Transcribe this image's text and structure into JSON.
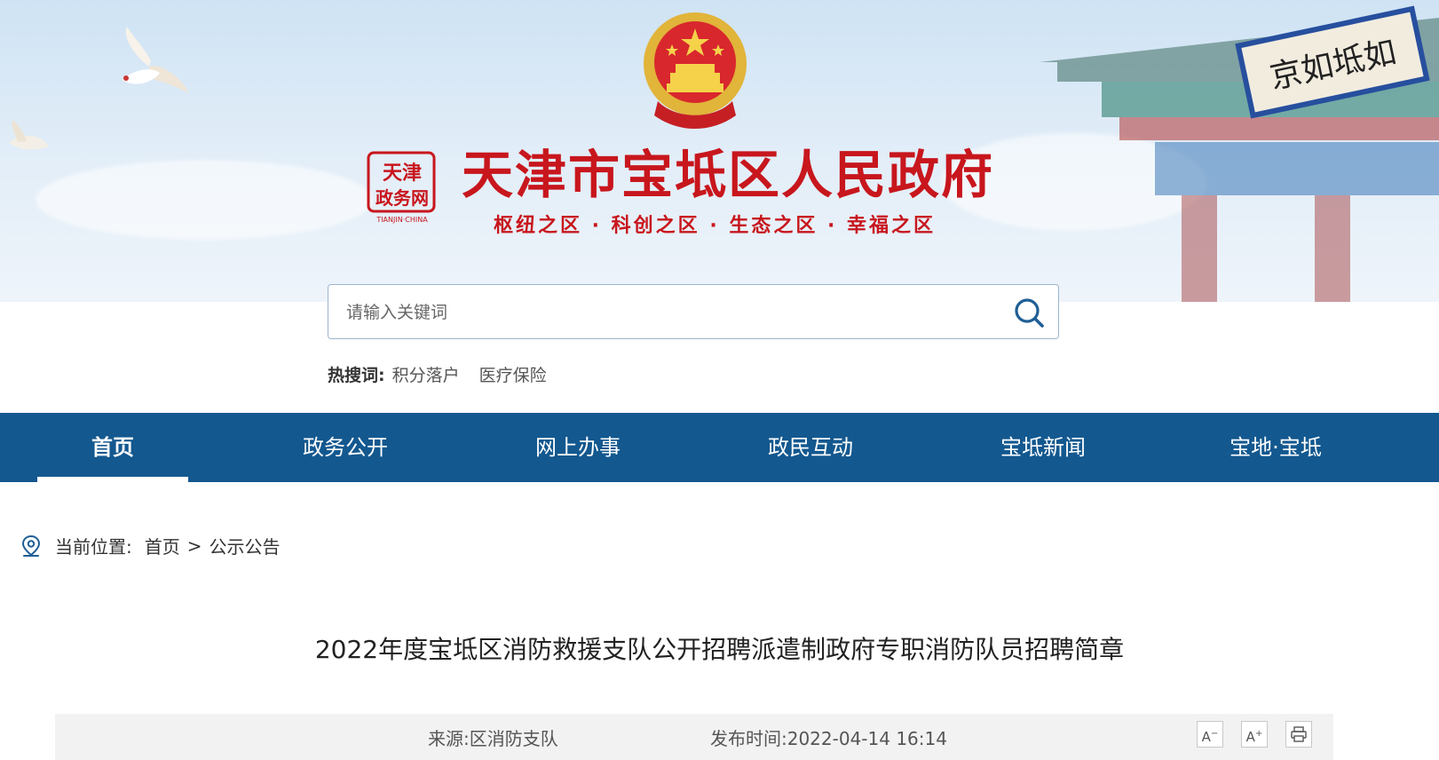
{
  "header": {
    "site_title": "天津市宝坻区人民政府",
    "slogan": "枢纽之区 · 科创之区 · 生态之区 · 幸福之区",
    "seal_text": "天津政务网",
    "seal_caption": "TIANJIN·CHINA",
    "gate_plaque": "京如坻如"
  },
  "search": {
    "placeholder": "请输入关键词",
    "hot_label": "热搜词:",
    "hot_words": [
      "积分落户",
      "医疗保险"
    ]
  },
  "nav": {
    "items": [
      "首页",
      "政务公开",
      "网上办事",
      "政民互动",
      "宝坻新闻",
      "宝地·宝坻"
    ],
    "active_index": 0
  },
  "breadcrumb": {
    "label": "当前位置:",
    "items": [
      "首页",
      "公示公告"
    ],
    "separator": ">"
  },
  "article": {
    "title": "2022年度宝坻区消防救援支队公开招聘派遣制政府专职消防队员招聘简章",
    "source": "来源:区消防支队",
    "publish_time": "发布时间:2022-04-14 16:14",
    "tools": {
      "font_smaller": "A",
      "font_larger": "A",
      "print_icon": "printer-icon"
    }
  },
  "colors": {
    "brand_red": "#c8161d",
    "nav_blue": "#13588f",
    "meta_bg": "#f2f2f2"
  }
}
